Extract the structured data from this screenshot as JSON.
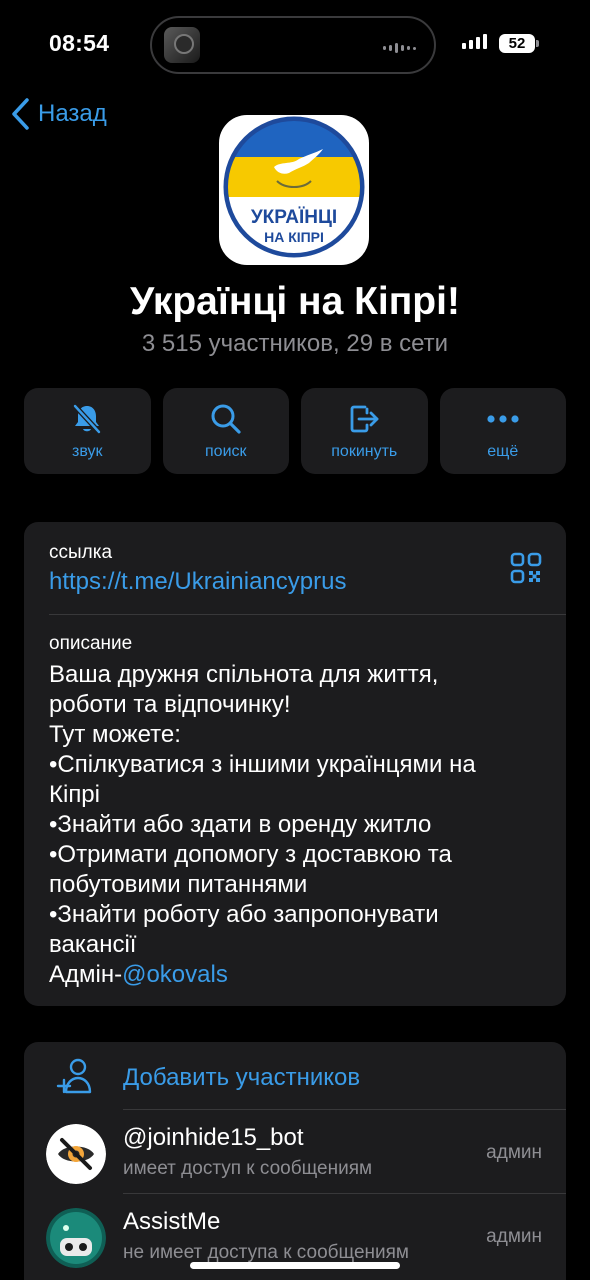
{
  "status_bar": {
    "time": "08:54",
    "battery": "52"
  },
  "nav": {
    "back_label": "Назад"
  },
  "group": {
    "logo_text_line1": "УКРАЇНЦІ",
    "logo_text_line2": "НА КІПРІ",
    "title": "Українці на Кіпрі!",
    "subtitle": "3 515 участников, 29 в сети"
  },
  "actions": [
    {
      "label": "звук",
      "icon": "bell-slash-icon"
    },
    {
      "label": "поиск",
      "icon": "search-icon"
    },
    {
      "label": "покинуть",
      "icon": "leave-icon"
    },
    {
      "label": "ещё",
      "icon": "more-icon"
    }
  ],
  "info": {
    "link_label": "ссылка",
    "link": "https://t.me/Ukrainiancyprus",
    "description_label": "описание",
    "description_lines": [
      "Ваша дружня спільнота для життя,",
      "роботи та відпочинку!",
      "Тут можете:",
      "•Спілкуватися з іншими українцями на",
      "Кіпрі",
      "•Знайти або здати в оренду житло",
      "•Отримати допомогу з доставкою та",
      "побутовими питаннями",
      "•Знайти роботу або запропонувати",
      "вакансії"
    ],
    "admin_prefix": "Адмін-",
    "admin_mention": "@okovals"
  },
  "members": {
    "add_label": "Добавить участников",
    "list": [
      {
        "name": "@joinhide15_bot",
        "status": "имеет доступ к сообщениям",
        "role": "админ"
      },
      {
        "name": "AssistMe",
        "status": "не имеет доступа к сообщениям",
        "role": "админ"
      }
    ]
  },
  "colors": {
    "accent": "#3a9ce8",
    "card": "#1c1c1e",
    "secondary_text": "#8e8e93",
    "background": "#000000"
  }
}
